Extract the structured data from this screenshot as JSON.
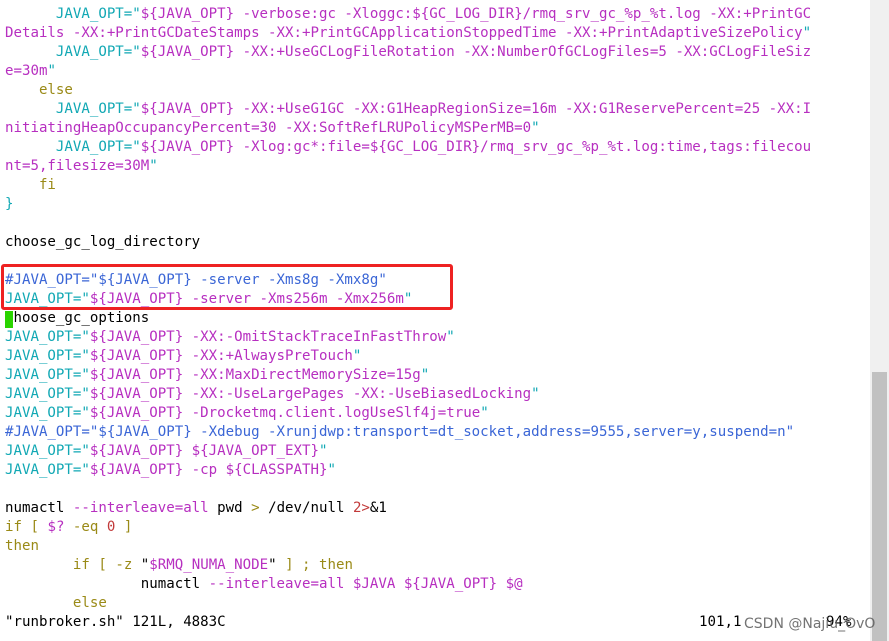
{
  "window": {
    "title": "runbroker.sh"
  },
  "colors": {
    "keyword": "#11a8b4",
    "string": "#b72fc0",
    "comment": "#3b66d6",
    "number": "#c23a3a",
    "control": "#9a8a17",
    "cursor": "#2ad400",
    "highlight_box": "#ee2222"
  },
  "editor": {
    "lines": [
      [
        {
          "t": "      JAVA_OPT=\"",
          "c": "cyan"
        },
        {
          "t": "${JAVA_OPT} -verbose:gc -Xloggc:${GC_LOG_DIR}/rmq_srv_gc_%p_%t.log -XX:+PrintGC",
          "c": "mag"
        }
      ],
      [
        {
          "t": "Details -XX:+PrintGCDateStamps -XX:+PrintGCApplicationStoppedTime -XX:+PrintAdaptiveSizePolicy",
          "c": "mag"
        },
        {
          "t": "\"",
          "c": "cyan"
        }
      ],
      [
        {
          "t": "      JAVA_OPT=\"",
          "c": "cyan"
        },
        {
          "t": "${JAVA_OPT} -XX:+UseGCLogFileRotation -XX:NumberOfGCLogFiles=5 -XX:GCLogFileSiz",
          "c": "mag"
        }
      ],
      [
        {
          "t": "e=30m",
          "c": "mag"
        },
        {
          "t": "\"",
          "c": "cyan"
        }
      ],
      [
        {
          "t": "    else",
          "c": "olive"
        }
      ],
      [
        {
          "t": "      JAVA_OPT=\"",
          "c": "cyan"
        },
        {
          "t": "${JAVA_OPT} -XX:+UseG1GC -XX:G1HeapRegionSize=16m -XX:G1ReservePercent=25 -XX:I",
          "c": "mag"
        }
      ],
      [
        {
          "t": "nitiatingHeapOccupancyPercent=30 -XX:SoftRefLRUPolicyMSPerMB=0",
          "c": "mag"
        },
        {
          "t": "\"",
          "c": "cyan"
        }
      ],
      [
        {
          "t": "      JAVA_OPT=\"",
          "c": "cyan"
        },
        {
          "t": "${JAVA_OPT} -Xlog:gc*:file=${GC_LOG_DIR}/rmq_srv_gc_%p_%t.log:time,tags:filecou",
          "c": "mag"
        }
      ],
      [
        {
          "t": "nt=5,filesize=30M",
          "c": "mag"
        },
        {
          "t": "\"",
          "c": "cyan"
        }
      ],
      [
        {
          "t": "    fi",
          "c": "olive"
        }
      ],
      [
        {
          "t": "}",
          "c": "cyan"
        }
      ],
      [
        {
          "t": "",
          "c": "black"
        }
      ],
      [
        {
          "t": "choose_gc_log_directory",
          "c": "black"
        }
      ],
      [
        {
          "t": "",
          "c": "black"
        }
      ],
      [
        {
          "t": "#JAVA_OPT=\"${JAVA_OPT} -server -Xms8g -Xmx8g\"",
          "c": "blue"
        }
      ],
      [
        {
          "t": "JAVA_OPT=\"",
          "c": "cyan"
        },
        {
          "t": "${JAVA_OPT} -server -Xms256m -Xmx256m",
          "c": "mag"
        },
        {
          "t": "\"",
          "c": "cyan"
        }
      ],
      [
        {
          "t": "choose_gc_options",
          "c": "black"
        }
      ],
      [
        {
          "t": "JAVA_OPT=\"",
          "c": "cyan"
        },
        {
          "t": "${JAVA_OPT} -XX:-OmitStackTraceInFastThrow",
          "c": "mag"
        },
        {
          "t": "\"",
          "c": "cyan"
        }
      ],
      [
        {
          "t": "JAVA_OPT=\"",
          "c": "cyan"
        },
        {
          "t": "${JAVA_OPT} -XX:+AlwaysPreTouch",
          "c": "mag"
        },
        {
          "t": "\"",
          "c": "cyan"
        }
      ],
      [
        {
          "t": "JAVA_OPT=\"",
          "c": "cyan"
        },
        {
          "t": "${JAVA_OPT} -XX:MaxDirectMemorySize=15g",
          "c": "mag"
        },
        {
          "t": "\"",
          "c": "cyan"
        }
      ],
      [
        {
          "t": "JAVA_OPT=\"",
          "c": "cyan"
        },
        {
          "t": "${JAVA_OPT} -XX:-UseLargePages -XX:-UseBiasedLocking",
          "c": "mag"
        },
        {
          "t": "\"",
          "c": "cyan"
        }
      ],
      [
        {
          "t": "JAVA_OPT=\"",
          "c": "cyan"
        },
        {
          "t": "${JAVA_OPT} -Drocketmq.client.logUseSlf4j=true",
          "c": "mag"
        },
        {
          "t": "\"",
          "c": "cyan"
        }
      ],
      [
        {
          "t": "#JAVA_OPT=\"${JAVA_OPT} -Xdebug -Xrunjdwp:transport=dt_socket,address=9555,server=y,suspend=n\"",
          "c": "blue"
        }
      ],
      [
        {
          "t": "JAVA_OPT=\"",
          "c": "cyan"
        },
        {
          "t": "${JAVA_OPT} ${JAVA_OPT_EXT}",
          "c": "mag"
        },
        {
          "t": "\"",
          "c": "cyan"
        }
      ],
      [
        {
          "t": "JAVA_OPT=\"",
          "c": "cyan"
        },
        {
          "t": "${JAVA_OPT} -cp ${CLASSPATH}",
          "c": "mag"
        },
        {
          "t": "\"",
          "c": "cyan"
        }
      ],
      [
        {
          "t": "",
          "c": "black"
        }
      ],
      [
        {
          "t": "numactl ",
          "c": "black"
        },
        {
          "t": "--interleave=all",
          "c": "mag"
        },
        {
          "t": " pwd ",
          "c": "black"
        },
        {
          "t": ">",
          "c": "olive"
        },
        {
          "t": " /dev/null ",
          "c": "black"
        },
        {
          "t": "2>",
          "c": "red"
        },
        {
          "t": "&1",
          "c": "black"
        }
      ],
      [
        {
          "t": "if",
          "c": "olive"
        },
        {
          "t": " [ ",
          "c": "olive"
        },
        {
          "t": "$?",
          "c": "mag"
        },
        {
          "t": " -eq ",
          "c": "olive"
        },
        {
          "t": "0",
          "c": "red"
        },
        {
          "t": " ]",
          "c": "olive"
        }
      ],
      [
        {
          "t": "then",
          "c": "olive"
        }
      ],
      [
        {
          "t": "        if",
          "c": "olive"
        },
        {
          "t": " [ ",
          "c": "olive"
        },
        {
          "t": "-z",
          "c": "olive"
        },
        {
          "t": " \"",
          "c": "black"
        },
        {
          "t": "$RMQ_NUMA_NODE",
          "c": "mag"
        },
        {
          "t": "\"",
          "c": "black"
        },
        {
          "t": " ] ; ",
          "c": "olive"
        },
        {
          "t": "then",
          "c": "olive"
        }
      ],
      [
        {
          "t": "                numactl ",
          "c": "black"
        },
        {
          "t": "--interleave=all",
          "c": "mag"
        },
        {
          "t": " $JAVA ${JAVA_OPT} $@",
          "c": "mag"
        }
      ],
      [
        {
          "t": "        else",
          "c": "olive"
        }
      ]
    ]
  },
  "statusbar": {
    "file_info": "\"runbroker.sh\" 121L, 4883C",
    "position": "101,1",
    "percent": "94%"
  },
  "watermark": "CSDN @Najiu_OvO",
  "scrollbar": {
    "thumb_fraction_start": 0.58,
    "thumb_fraction_size": 0.42
  }
}
